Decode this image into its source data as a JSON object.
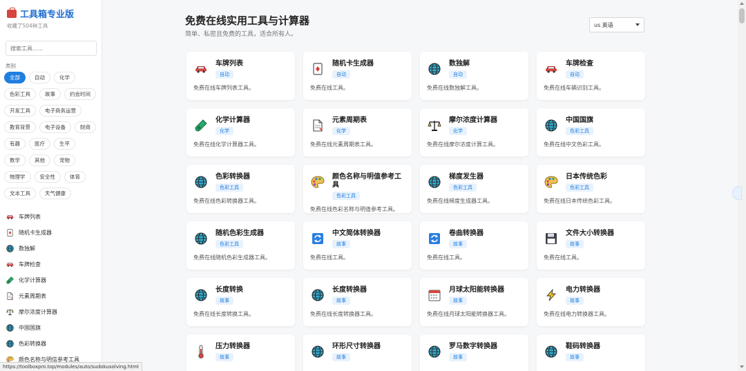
{
  "sidebar": {
    "title": "工具箱专业版",
    "subtitle": "收藏了504种工具",
    "search_placeholder": "搜索工具......",
    "category_heading": "类别",
    "chips": [
      "全部",
      "自动",
      "化学",
      "色彩工具",
      "故事",
      "约会时间",
      "开发工具",
      "电子商务运营",
      "教育背景",
      "电子设备",
      "财商",
      "有趣",
      "医疗",
      "生平",
      "数学",
      "其他",
      "宠物",
      "物理学",
      "安全性",
      "体育",
      "文本工具",
      "天气健康"
    ],
    "items": [
      {
        "label": "车牌列表",
        "icon": "car-icon"
      },
      {
        "label": "随机卡生成器",
        "icon": "card-icon"
      },
      {
        "label": "数独解",
        "icon": "globe-icon"
      },
      {
        "label": "车牌检查",
        "icon": "car-icon"
      },
      {
        "label": "化学计算器",
        "icon": "test-tube-icon"
      },
      {
        "label": "元素周期表",
        "icon": "document-icon"
      },
      {
        "label": "摩尔浓度计算器",
        "icon": "scale-icon"
      },
      {
        "label": "中国国旗",
        "icon": "globe-icon"
      },
      {
        "label": "色彩转换器",
        "icon": "globe-icon"
      },
      {
        "label": "颜色名称与明信参考工具",
        "icon": "palette-icon"
      }
    ]
  },
  "header": {
    "title": "免费在线实用工具与计算器",
    "subtitle": "简单、私密且免费的工具，适合所有人。",
    "language": "us 英语"
  },
  "tools": [
    {
      "name": "车牌列表",
      "badge": "自动",
      "desc": "免费在线车牌列表工具。",
      "icon": "car-icon"
    },
    {
      "name": "随机卡生成器",
      "badge": "自动",
      "desc": "免费在线工具。",
      "icon": "card-icon"
    },
    {
      "name": "数独解",
      "badge": "自动",
      "desc": "免费在线数独解工具。",
      "icon": "globe-icon"
    },
    {
      "name": "车牌检查",
      "badge": "自动",
      "desc": "免费在线车辆识别工具。",
      "icon": "car-icon"
    },
    {
      "name": "化学计算器",
      "badge": "化学",
      "desc": "免费在线化学计算器工具。",
      "icon": "test-tube-icon"
    },
    {
      "name": "元素周期表",
      "badge": "化学",
      "desc": "免费在线元素周期表工具。",
      "icon": "document-icon"
    },
    {
      "name": "摩尔浓度计算器",
      "badge": "化学",
      "desc": "免费在线摩尔浓度计算工具。",
      "icon": "scale-icon"
    },
    {
      "name": "中国国旗",
      "badge": "色彩工具",
      "desc": "免费在线中文色彩工具。",
      "icon": "globe-icon"
    },
    {
      "name": "色彩转换器",
      "badge": "色彩工具",
      "desc": "免费在线色彩转换器工具。",
      "icon": "globe-icon"
    },
    {
      "name": "颜色名称与明值参考工具",
      "badge": "色彩工具",
      "desc": "免费在线色彩名称与明值参考工具。",
      "icon": "palette-icon"
    },
    {
      "name": "梯度发生器",
      "badge": "色彩工具",
      "desc": "免费在线梯度生成器工具。",
      "icon": "globe-icon"
    },
    {
      "name": "日本传统色彩",
      "badge": "色彩工具",
      "desc": "免费在线日本传统色彩工具。",
      "icon": "palette-icon"
    },
    {
      "name": "随机色彩生成器",
      "badge": "色彩工具",
      "desc": "免费在线随机色彩生成器工具。",
      "icon": "globe-icon"
    },
    {
      "name": "中文简体转换器",
      "badge": "故事",
      "desc": "免费在线工具。",
      "icon": "convert-icon"
    },
    {
      "name": "卷曲转换器",
      "badge": "故事",
      "desc": "免费在线工具。",
      "icon": "convert-icon"
    },
    {
      "name": "文件大小转换器",
      "badge": "故事",
      "desc": "免费在线工具。",
      "icon": "floppy-icon"
    },
    {
      "name": "长度转换",
      "badge": "故事",
      "desc": "免费在线长度转换工具。",
      "icon": "globe-icon"
    },
    {
      "name": "长度转换器",
      "badge": "故事",
      "desc": "免费在线长度转换器工具。",
      "icon": "globe-icon"
    },
    {
      "name": "月球太阳能转换器",
      "badge": "故事",
      "desc": "免费在线月球太阳能转换器工具。",
      "icon": "calendar-icon"
    },
    {
      "name": "电力转换器",
      "badge": "故事",
      "desc": "免费在线电力转换器工具。",
      "icon": "lightning-icon"
    },
    {
      "name": "压力转换器",
      "badge": "故事",
      "desc": "",
      "icon": "thermometer-icon"
    },
    {
      "name": "环形尺寸转换器",
      "badge": "故事",
      "desc": "",
      "icon": "globe-icon"
    },
    {
      "name": "罗马数字转换器",
      "badge": "故事",
      "desc": "",
      "icon": "globe-icon"
    },
    {
      "name": "鞋码转换器",
      "badge": "故事",
      "desc": "",
      "icon": "globe-icon"
    }
  ],
  "status_url": "https://toolboxpro.top/modules/auto/sudokusolving.html",
  "colors": {
    "accent": "#1f7fe0",
    "brand_title": "#1f6fd1",
    "background": "#f6f7f9"
  }
}
